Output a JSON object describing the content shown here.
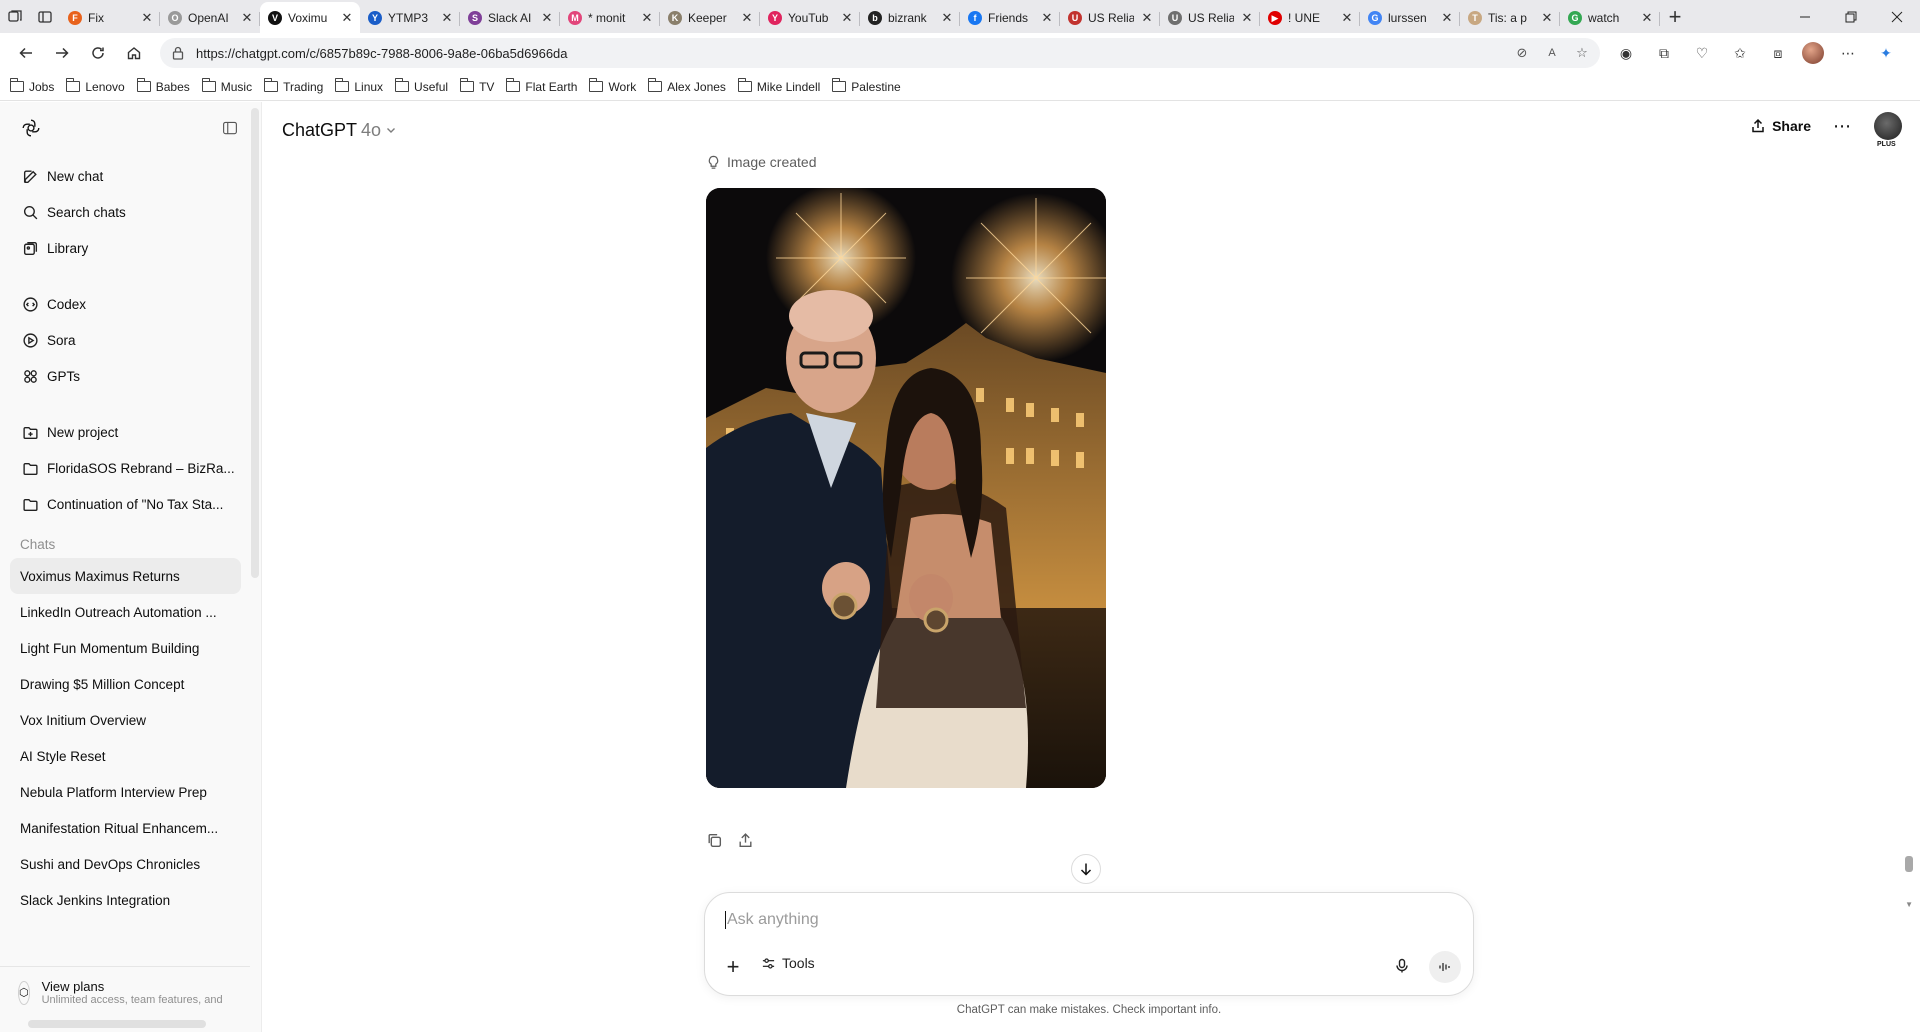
{
  "browser": {
    "tabs": [
      {
        "label": "Fix",
        "color": "#e8621c",
        "glyph": "F"
      },
      {
        "label": "OpenAI",
        "color": "#9a9a9a",
        "glyph": "O"
      },
      {
        "label": "Voximu",
        "color": "#111111",
        "glyph": "V",
        "active": true
      },
      {
        "label": "YTMP3",
        "color": "#1a5dc8",
        "glyph": "Y"
      },
      {
        "label": "Slack AI",
        "color": "#7f3f98",
        "glyph": "S"
      },
      {
        "label": "* monit",
        "color": "#e2457a",
        "glyph": "M"
      },
      {
        "label": "Keeper",
        "color": "#8a7f6b",
        "glyph": "K"
      },
      {
        "label": "YouTub",
        "color": "#e0245e",
        "glyph": "Y"
      },
      {
        "label": "bizrank",
        "color": "#222222",
        "glyph": "b"
      },
      {
        "label": "Friends",
        "color": "#1877f2",
        "glyph": "f"
      },
      {
        "label": "US Relia",
        "color": "#c2332f",
        "glyph": "U"
      },
      {
        "label": "US Relia",
        "color": "#6f6f6f",
        "glyph": "U"
      },
      {
        "label": "! UNE",
        "color": "#e00000",
        "glyph": "▶"
      },
      {
        "label": "lurssen",
        "color": "#4285f4",
        "glyph": "G"
      },
      {
        "label": "Tis: a p",
        "color": "#c8a882",
        "glyph": "T"
      },
      {
        "label": "watch",
        "color": "#34a853",
        "glyph": "G"
      }
    ],
    "url": "https://chatgpt.com/c/6857b89c-7988-8006-9a8e-06ba5d6966da",
    "bookmarks": [
      "Jobs",
      "Lenovo",
      "Babes",
      "Music",
      "Trading",
      "Linux",
      "Useful",
      "TV",
      "Flat Earth",
      "Work",
      "Alex Jones",
      "Mike Lindell",
      "Palestine"
    ]
  },
  "sidebar": {
    "primary": [
      {
        "label": "New chat",
        "icon": "edit-icon"
      },
      {
        "label": "Search chats",
        "icon": "search-icon"
      },
      {
        "label": "Library",
        "icon": "library-icon"
      }
    ],
    "tools": [
      {
        "label": "Codex",
        "icon": "codex-icon"
      },
      {
        "label": "Sora",
        "icon": "sora-icon"
      },
      {
        "label": "GPTs",
        "icon": "gpts-icon"
      }
    ],
    "projects": [
      {
        "label": "New project",
        "icon": "new-folder-icon"
      },
      {
        "label": "FloridaSOS Rebrand – BizRa...",
        "icon": "folder-icon"
      },
      {
        "label": "Continuation of \"No Tax Sta...",
        "icon": "folder-icon"
      }
    ],
    "chats_heading": "Chats",
    "chats": [
      "Voximus Maximus Returns",
      "LinkedIn Outreach Automation ...",
      "Light Fun Momentum Building",
      "Drawing $5 Million Concept",
      "Vox Initium Overview",
      "AI Style Reset",
      "Nebula Platform Interview Prep",
      "Manifestation Ritual Enhancem...",
      "Sushi and DevOps Chronicles",
      "Slack Jenkins Integration"
    ],
    "footer": {
      "title": "View plans",
      "subtitle": "Unlimited access, team features, and"
    }
  },
  "header": {
    "model": "ChatGPT",
    "version": "4o",
    "share": "Share",
    "plan_badge": "PLUS"
  },
  "conversation": {
    "status": "Image created"
  },
  "composer": {
    "placeholder": "Ask anything",
    "tools_label": "Tools"
  },
  "disclaimer": "ChatGPT can make mistakes. Check important info.",
  "colors": {
    "sidebar_bg": "#f9f9f9",
    "selected_chat": "#ececec",
    "text": "#0d0d0d",
    "muted": "#8f8f8f"
  }
}
